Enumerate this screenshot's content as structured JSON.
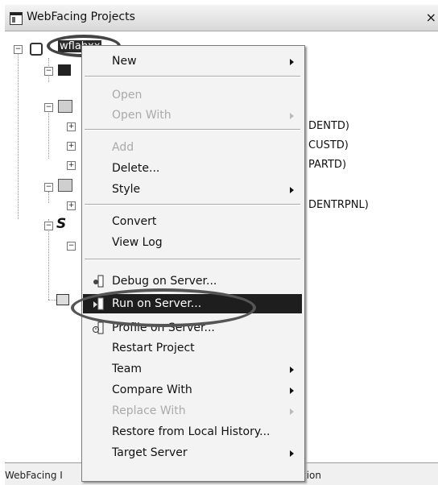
{
  "window": {
    "title": "WebFacing Projects",
    "close_glyph": "×"
  },
  "tree": {
    "root_label": "wflabxx",
    "background_fragments": [
      "DENTD)",
      "CUSTD)",
      "PARTD)",
      "DENTRPNL)"
    ]
  },
  "context_menu": {
    "items": [
      {
        "label": "New",
        "submenu": true,
        "enabled": true
      },
      {
        "label": "Open",
        "submenu": false,
        "enabled": false
      },
      {
        "label": "Open With",
        "submenu": true,
        "enabled": false
      },
      {
        "label": "Add",
        "submenu": false,
        "enabled": false
      },
      {
        "label": "Delete...",
        "submenu": false,
        "enabled": true
      },
      {
        "label": "Style",
        "submenu": true,
        "enabled": true
      },
      {
        "label": "Convert",
        "submenu": false,
        "enabled": true
      },
      {
        "label": "View Log",
        "submenu": false,
        "enabled": true
      },
      {
        "label": "Debug on Server...",
        "submenu": false,
        "enabled": true,
        "icon": "debug-server-icon"
      },
      {
        "label": "Run on Server...",
        "submenu": false,
        "enabled": true,
        "selected": true,
        "icon": "run-server-icon"
      },
      {
        "label": "Profile on Server...",
        "submenu": false,
        "enabled": true,
        "icon": "profile-server-icon"
      },
      {
        "label": "Restart Project",
        "submenu": false,
        "enabled": true
      },
      {
        "label": "Team",
        "submenu": true,
        "enabled": true
      },
      {
        "label": "Compare With",
        "submenu": true,
        "enabled": true
      },
      {
        "label": "Replace With",
        "submenu": true,
        "enabled": false
      },
      {
        "label": "Restore from Local History...",
        "submenu": false,
        "enabled": true
      },
      {
        "label": "Target Server",
        "submenu": true,
        "enabled": true
      }
    ]
  },
  "status_bar": {
    "left_text": "WebFacing I",
    "right_text": "tion"
  },
  "colors": {
    "selection": "#1e1e1e",
    "menu_background": "#f3f3f3",
    "disabled_text": "#aaaaaa"
  }
}
